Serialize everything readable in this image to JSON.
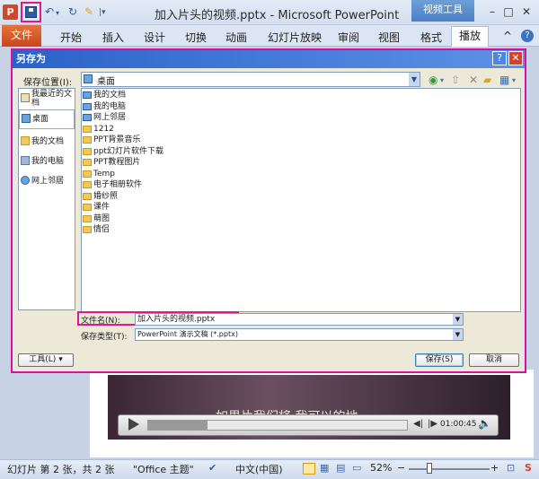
{
  "titlebar": {
    "app_icon": "P",
    "doc_title": "加入片头的视频.pptx - Microsoft PowerPoint",
    "context_tab": "视频工具",
    "min": "–",
    "max": "□",
    "close": "✕"
  },
  "ribbon": {
    "file": "文件",
    "tabs": [
      "开始",
      "插入",
      "设计",
      "切换",
      "动画",
      "幻灯片放映",
      "审阅",
      "视图",
      "格式",
      "播放"
    ],
    "collapse": "^",
    "help": "?"
  },
  "video": {
    "subtitle": "如果片我们将 我可以的地",
    "time": "01:00:45"
  },
  "statusbar": {
    "slide_info": "幻灯片 第 2 张，共 2 张",
    "theme": "\"Office 主题\"",
    "language": "中文(中国)",
    "zoom": "52%",
    "zoom_minus": "−",
    "zoom_plus": "+"
  },
  "dialog": {
    "title": "另存为",
    "help": "?",
    "close": "✕",
    "location_label": "保存位置(I):",
    "location_value": "桌面",
    "places": [
      {
        "label": "我最近的文档"
      },
      {
        "label": "桌面"
      },
      {
        "label": "我的文档"
      },
      {
        "label": "我的电脑"
      },
      {
        "label": "网上邻居"
      }
    ],
    "files": [
      {
        "name": "我的文档",
        "kind": "sys"
      },
      {
        "name": "我的电脑",
        "kind": "sys"
      },
      {
        "name": "网上邻居",
        "kind": "sys"
      },
      {
        "name": "1212",
        "kind": "folder"
      },
      {
        "name": "PPT背景音乐",
        "kind": "folder"
      },
      {
        "name": "ppt幻灯片软件下载",
        "kind": "folder"
      },
      {
        "name": "PPT教程图片",
        "kind": "folder"
      },
      {
        "name": "Temp",
        "kind": "folder"
      },
      {
        "name": "电子相册软件",
        "kind": "folder"
      },
      {
        "name": "婚纱照",
        "kind": "folder"
      },
      {
        "name": "课件",
        "kind": "folder"
      },
      {
        "name": "萌图",
        "kind": "folder"
      },
      {
        "name": "情侣",
        "kind": "folder"
      }
    ],
    "filename_label": "文件名(N):",
    "filename_value": "加入片头的视频.pptx",
    "filetype_label": "保存类型(T):",
    "filetype_value": "PowerPoint 演示文稿 (*.pptx)",
    "tools_button": "工具(L)",
    "save_button": "保存(S)",
    "cancel_button": "取消"
  }
}
